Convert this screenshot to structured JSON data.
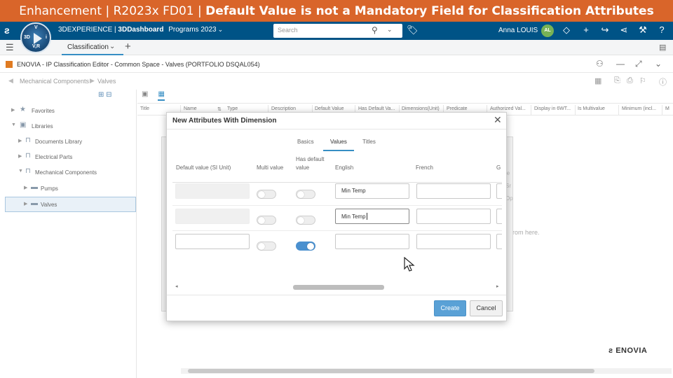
{
  "banner": {
    "prefix": "Enhancement | R2023x FD01 | ",
    "title": "Default Value is not a Mandatory Field for Classification Attributes"
  },
  "topbar": {
    "brand_light": "3DEXPERIENCE | ",
    "brand_bold": "3DDashboard",
    "dashboard": "Programs 2023",
    "search_placeholder": "Search",
    "user_name": "Anna LOUIS",
    "user_initials": "AL",
    "compass_labels": {
      "top": "V",
      "left": "3D",
      "right": "i",
      "bottom": "V,R"
    }
  },
  "tabbar": {
    "tab_label": "Classification"
  },
  "app_header": {
    "title": "ENOVIA - IP Classification Editor - Common Space - Valves (PORTFOLIO DSQAL054)"
  },
  "breadcrumb": {
    "items": [
      "Mechanical Components",
      "Valves"
    ]
  },
  "tree": {
    "items": [
      {
        "label": "Favorites"
      },
      {
        "label": "Libraries"
      },
      {
        "label": "Documents Library"
      },
      {
        "label": "Electrical Parts"
      },
      {
        "label": "Mechanical Components"
      },
      {
        "label": "Pumps"
      },
      {
        "label": "Valves"
      }
    ]
  },
  "table": {
    "columns": [
      "Title",
      "Name",
      "Type",
      "Description",
      "Default Value",
      "Has Default Va...",
      "Dimensions(Unit)",
      "Predicate",
      "Authorized Val...",
      "Display in 6WT...",
      "Is Multivalue",
      "Minimum (incl...",
      "M"
    ],
    "drop_hint": "rom here."
  },
  "ghost": {
    "side_text": [
      "le",
      "Sr",
      "Op"
    ]
  },
  "footer": {
    "brand": "ENOVIA"
  },
  "modal": {
    "title": "New Attributes With Dimension",
    "tabs": [
      "Basics",
      "Values",
      "Titles"
    ],
    "active_tab": "Values",
    "headers": {
      "default_value": "Default value (SI Unit)",
      "multi_value": "Multi value",
      "has_default_1": "Has default",
      "has_default_2": "value",
      "english": "English",
      "french": "French",
      "next": "G"
    },
    "rows": [
      {
        "default_value": "",
        "multi_value": false,
        "has_default": false,
        "english": "Min Temp",
        "french": ""
      },
      {
        "default_value": "",
        "multi_value": false,
        "has_default": false,
        "english": "Min Temp",
        "french": ""
      },
      {
        "default_value": "",
        "multi_value": false,
        "has_default": true,
        "english": "",
        "french": ""
      }
    ],
    "create_label": "Create",
    "cancel_label": "Cancel"
  },
  "colors": {
    "banner": "#d9652a",
    "topbar": "#005386",
    "accent": "#368ec4",
    "create_button": "#5aa1d6"
  },
  "icons": [
    "ds-logo-icon",
    "search-icon",
    "tag-icon",
    "share-icon",
    "add-icon",
    "forward-icon",
    "network-icon",
    "tools-icon",
    "help-icon",
    "hamburger-icon",
    "chat-icon",
    "close-icon",
    "star-icon",
    "folder-icon",
    "library-icon",
    "mouse-pointer-icon"
  ]
}
